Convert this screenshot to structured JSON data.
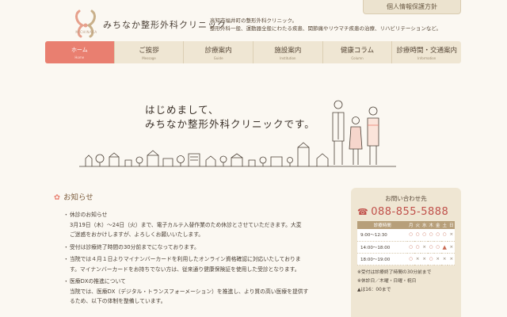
{
  "header": {
    "privacy_link": "個人情報保護方針",
    "logo_roman": "MICHINAKA",
    "logo_text": "みちなか整形外科クリニック",
    "desc_lines": [
      "高知市福井町の整形外科クリニック。",
      "整形外科一般、運動器全般にわたる疾患、関節痛やリウマチ疾患の治療、リハビリテーションなど。"
    ]
  },
  "nav": [
    {
      "ja": "ホーム",
      "en": "Home"
    },
    {
      "ja": "ご挨拶",
      "en": "Message"
    },
    {
      "ja": "診療案内",
      "en": "Guide"
    },
    {
      "ja": "施設案内",
      "en": "Institution"
    },
    {
      "ja": "健康コラム",
      "en": "Column"
    },
    {
      "ja": "診療時間・交通案内",
      "en": "Information"
    }
  ],
  "hero": {
    "lines": [
      "はじめまして、",
      "みちなか整形外科クリニックです。"
    ]
  },
  "news": {
    "title": "お知らせ",
    "items": [
      [
        "休診のお知らせ",
        "3月19日（木）〜24日（火）まで、電子カルテ入替作業のため休診とさせていただきます。大変",
        "ご迷惑をおかけしますが、よろしくお願いいたします。"
      ],
      [
        "受付は診療終了時間の30分前までになっております。"
      ],
      [
        "当院では４月１日よりマイナンバーカードを利用したオンライン資格確認に対応いたしておりま",
        "す。マイナンバーカードをお持ちでない方は、従来通り健康保険証を使用した受診となります。"
      ],
      [
        "医療DXの推進について",
        "当院では、医療DX（デジタル・トランスフォーメーション）を推進し、より質の高い医療を提供す",
        "るため、以下の体制を整備しています。"
      ]
    ]
  },
  "contact": {
    "title": "お問い合わせ先",
    "phone": "088-855-5888",
    "table": {
      "headers": [
        "診療時間",
        "月",
        "火",
        "水",
        "木",
        "金",
        "土",
        "日"
      ],
      "rows": [
        [
          "9:00〜12:30",
          "○",
          "○",
          "○",
          "○",
          "○",
          "○",
          "×"
        ],
        [
          "14:00〜18:00",
          "○",
          "○",
          "×",
          "○",
          "○",
          "▲",
          "×"
        ],
        [
          "18:00〜19:00",
          "○",
          "×",
          "×",
          "○",
          "×",
          "×",
          "×"
        ]
      ]
    },
    "notes": [
      "※受付は診療終了時間の30分前まで",
      "※休診日／木曜・日曜・祝日",
      "▲は16：00まで"
    ]
  },
  "colors": {
    "accent": "#e97f70",
    "bg": "#fbf8f2",
    "panel": "#efe6d3",
    "phone": "#c0504a"
  }
}
